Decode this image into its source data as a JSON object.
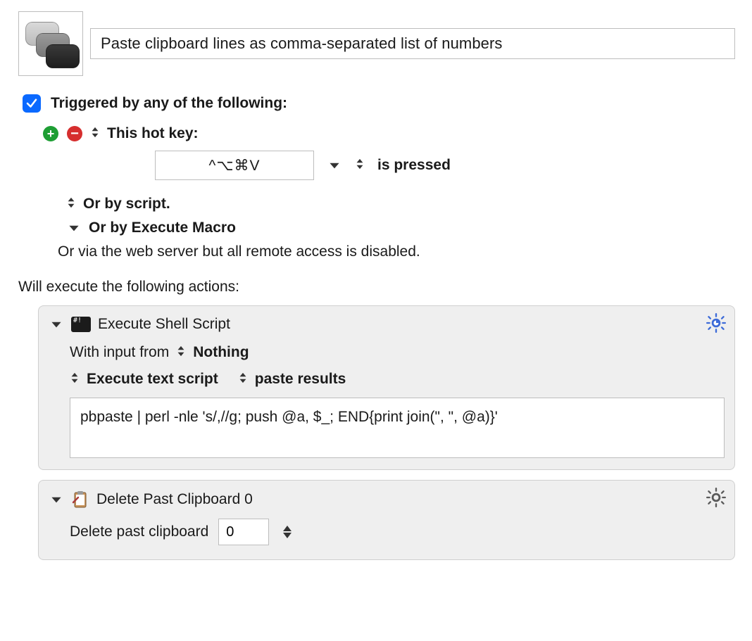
{
  "macro": {
    "title": "Paste clipboard lines as comma-separated list of numbers",
    "triggered_label": "Triggered by any of the following:",
    "hotkey": {
      "label": "This hot key:",
      "key_display": "^⌥⌘V",
      "condition": "is pressed"
    },
    "or_script": "Or by script.",
    "or_execute_macro": "Or by Execute Macro",
    "or_web_server": "Or via the web server but all remote access is disabled.",
    "will_execute": "Will execute the following actions:"
  },
  "actions": [
    {
      "title": "Execute Shell Script",
      "input_prefix": "With input from",
      "input_source": "Nothing",
      "mode": "Execute text script",
      "output": "paste results",
      "script": "pbpaste | perl -nle 's/,//g; push @a, $_; END{print join(\", \", @a)}'"
    },
    {
      "title": "Delete Past Clipboard 0",
      "label": "Delete past clipboard",
      "value": "0"
    }
  ]
}
